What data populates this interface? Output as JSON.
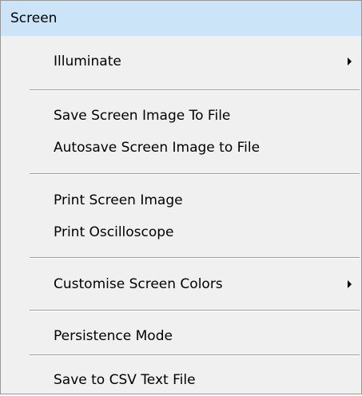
{
  "menu": {
    "title": "Screen",
    "items": [
      {
        "label": "Illuminate",
        "has_submenu": true
      },
      {
        "label": "Save Screen Image To File",
        "has_submenu": false
      },
      {
        "label": "Autosave Screen Image to File",
        "has_submenu": false
      },
      {
        "label": "Print Screen Image",
        "has_submenu": false
      },
      {
        "label": "Print Oscilloscope",
        "has_submenu": false
      },
      {
        "label": "Customise Screen Colors",
        "has_submenu": true
      },
      {
        "label": "Persistence Mode",
        "has_submenu": false
      },
      {
        "label": "Save to CSV Text File",
        "has_submenu": false
      }
    ],
    "icons": {
      "submenu": "caret-right-icon"
    },
    "colors": {
      "header_highlight": "#cce4f7",
      "menu_background": "#f0f0f0",
      "separator": "#a0a0a0"
    }
  }
}
